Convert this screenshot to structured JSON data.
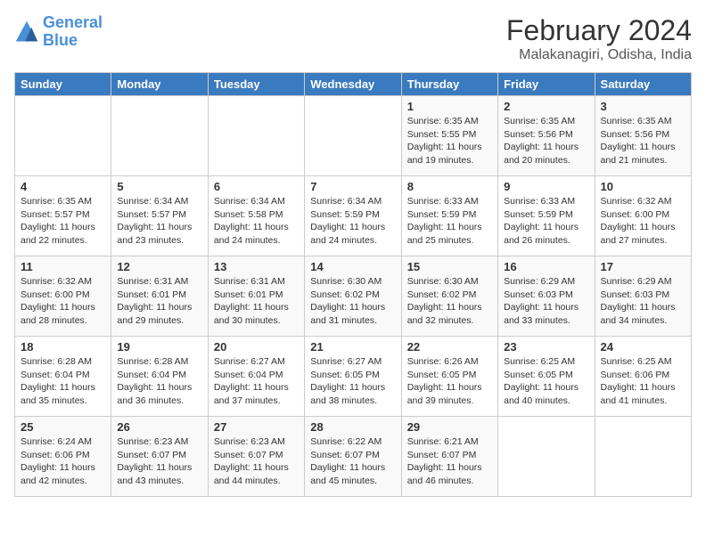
{
  "logo": {
    "line1": "General",
    "line2": "Blue"
  },
  "title": "February 2024",
  "location": "Malakanagiri, Odisha, India",
  "days_of_week": [
    "Sunday",
    "Monday",
    "Tuesday",
    "Wednesday",
    "Thursday",
    "Friday",
    "Saturday"
  ],
  "weeks": [
    [
      {
        "day": "",
        "info": ""
      },
      {
        "day": "",
        "info": ""
      },
      {
        "day": "",
        "info": ""
      },
      {
        "day": "",
        "info": ""
      },
      {
        "day": "1",
        "info": "Sunrise: 6:35 AM\nSunset: 5:55 PM\nDaylight: 11 hours\nand 19 minutes."
      },
      {
        "day": "2",
        "info": "Sunrise: 6:35 AM\nSunset: 5:56 PM\nDaylight: 11 hours\nand 20 minutes."
      },
      {
        "day": "3",
        "info": "Sunrise: 6:35 AM\nSunset: 5:56 PM\nDaylight: 11 hours\nand 21 minutes."
      }
    ],
    [
      {
        "day": "4",
        "info": "Sunrise: 6:35 AM\nSunset: 5:57 PM\nDaylight: 11 hours\nand 22 minutes."
      },
      {
        "day": "5",
        "info": "Sunrise: 6:34 AM\nSunset: 5:57 PM\nDaylight: 11 hours\nand 23 minutes."
      },
      {
        "day": "6",
        "info": "Sunrise: 6:34 AM\nSunset: 5:58 PM\nDaylight: 11 hours\nand 24 minutes."
      },
      {
        "day": "7",
        "info": "Sunrise: 6:34 AM\nSunset: 5:59 PM\nDaylight: 11 hours\nand 24 minutes."
      },
      {
        "day": "8",
        "info": "Sunrise: 6:33 AM\nSunset: 5:59 PM\nDaylight: 11 hours\nand 25 minutes."
      },
      {
        "day": "9",
        "info": "Sunrise: 6:33 AM\nSunset: 5:59 PM\nDaylight: 11 hours\nand 26 minutes."
      },
      {
        "day": "10",
        "info": "Sunrise: 6:32 AM\nSunset: 6:00 PM\nDaylight: 11 hours\nand 27 minutes."
      }
    ],
    [
      {
        "day": "11",
        "info": "Sunrise: 6:32 AM\nSunset: 6:00 PM\nDaylight: 11 hours\nand 28 minutes."
      },
      {
        "day": "12",
        "info": "Sunrise: 6:31 AM\nSunset: 6:01 PM\nDaylight: 11 hours\nand 29 minutes."
      },
      {
        "day": "13",
        "info": "Sunrise: 6:31 AM\nSunset: 6:01 PM\nDaylight: 11 hours\nand 30 minutes."
      },
      {
        "day": "14",
        "info": "Sunrise: 6:30 AM\nSunset: 6:02 PM\nDaylight: 11 hours\nand 31 minutes."
      },
      {
        "day": "15",
        "info": "Sunrise: 6:30 AM\nSunset: 6:02 PM\nDaylight: 11 hours\nand 32 minutes."
      },
      {
        "day": "16",
        "info": "Sunrise: 6:29 AM\nSunset: 6:03 PM\nDaylight: 11 hours\nand 33 minutes."
      },
      {
        "day": "17",
        "info": "Sunrise: 6:29 AM\nSunset: 6:03 PM\nDaylight: 11 hours\nand 34 minutes."
      }
    ],
    [
      {
        "day": "18",
        "info": "Sunrise: 6:28 AM\nSunset: 6:04 PM\nDaylight: 11 hours\nand 35 minutes."
      },
      {
        "day": "19",
        "info": "Sunrise: 6:28 AM\nSunset: 6:04 PM\nDaylight: 11 hours\nand 36 minutes."
      },
      {
        "day": "20",
        "info": "Sunrise: 6:27 AM\nSunset: 6:04 PM\nDaylight: 11 hours\nand 37 minutes."
      },
      {
        "day": "21",
        "info": "Sunrise: 6:27 AM\nSunset: 6:05 PM\nDaylight: 11 hours\nand 38 minutes."
      },
      {
        "day": "22",
        "info": "Sunrise: 6:26 AM\nSunset: 6:05 PM\nDaylight: 11 hours\nand 39 minutes."
      },
      {
        "day": "23",
        "info": "Sunrise: 6:25 AM\nSunset: 6:05 PM\nDaylight: 11 hours\nand 40 minutes."
      },
      {
        "day": "24",
        "info": "Sunrise: 6:25 AM\nSunset: 6:06 PM\nDaylight: 11 hours\nand 41 minutes."
      }
    ],
    [
      {
        "day": "25",
        "info": "Sunrise: 6:24 AM\nSunset: 6:06 PM\nDaylight: 11 hours\nand 42 minutes."
      },
      {
        "day": "26",
        "info": "Sunrise: 6:23 AM\nSunset: 6:07 PM\nDaylight: 11 hours\nand 43 minutes."
      },
      {
        "day": "27",
        "info": "Sunrise: 6:23 AM\nSunset: 6:07 PM\nDaylight: 11 hours\nand 44 minutes."
      },
      {
        "day": "28",
        "info": "Sunrise: 6:22 AM\nSunset: 6:07 PM\nDaylight: 11 hours\nand 45 minutes."
      },
      {
        "day": "29",
        "info": "Sunrise: 6:21 AM\nSunset: 6:07 PM\nDaylight: 11 hours\nand 46 minutes."
      },
      {
        "day": "",
        "info": ""
      },
      {
        "day": "",
        "info": ""
      }
    ]
  ]
}
